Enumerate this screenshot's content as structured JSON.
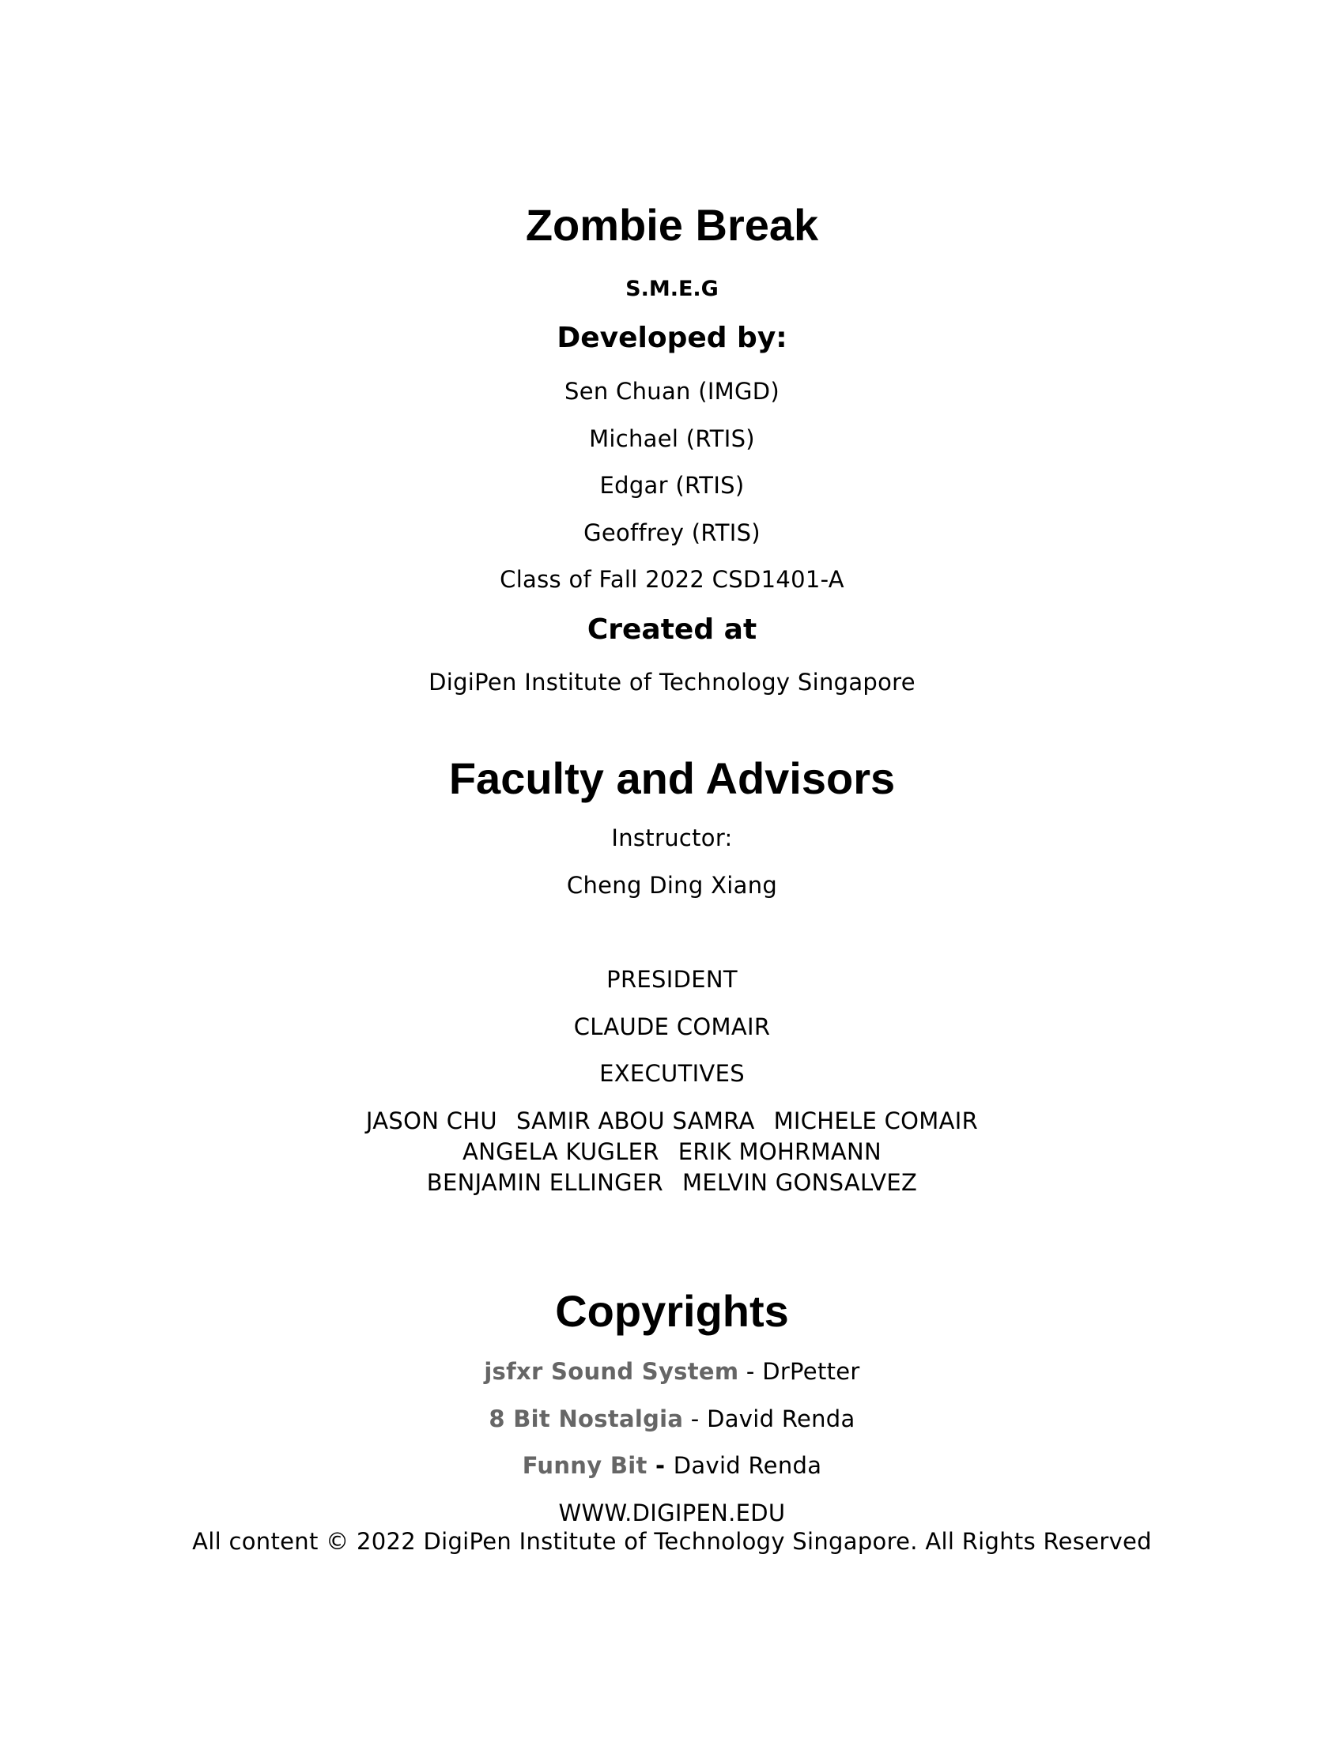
{
  "title": "Zombie Break",
  "team": "S.M.E.G",
  "developed_heading": "Developed by:",
  "developers": [
    "Sen Chuan (IMGD)",
    "Michael (RTIS)",
    "Edgar (RTIS)",
    "Geoffrey (RTIS)"
  ],
  "class_line": "Class of Fall 2022 CSD1401-A",
  "created_heading": "Created at",
  "institution": "DigiPen Institute of Technology Singapore",
  "faculty": {
    "heading": "Faculty and Advisors",
    "instructor_label": "Instructor:",
    "instructor_name": "Cheng Ding Xiang",
    "president_label": "PRESIDENT",
    "president_name": "CLAUDE COMAIR",
    "executives_label": "EXECUTIVES",
    "executive_rows": [
      [
        "JASON CHU",
        "SAMIR ABOU SAMRA",
        "MICHELE COMAIR"
      ],
      [
        "ANGELA KUGLER",
        "ERIK MOHRMANN"
      ],
      [
        "BENJAMIN ELLINGER",
        "MELVIN GONSALVEZ"
      ]
    ]
  },
  "copyrights": {
    "heading": "Copyrights",
    "items": [
      {
        "work": "jsfxr Sound System",
        "separator": " - ",
        "author": "DrPetter"
      },
      {
        "work": "8 Bit Nostalgia",
        "separator": " - ",
        "author": "David Renda"
      },
      {
        "work": "Funny Bit",
        "separator": " - ",
        "author": "David Renda"
      }
    ]
  },
  "website": "WWW.DIGIPEN.EDU",
  "legal": "All content © 2022 DigiPen Institute of Technology Singapore. All Rights Reserved",
  "colors": {
    "text": "#000000",
    "credit_title": "#666666",
    "background": "#ffffff"
  }
}
